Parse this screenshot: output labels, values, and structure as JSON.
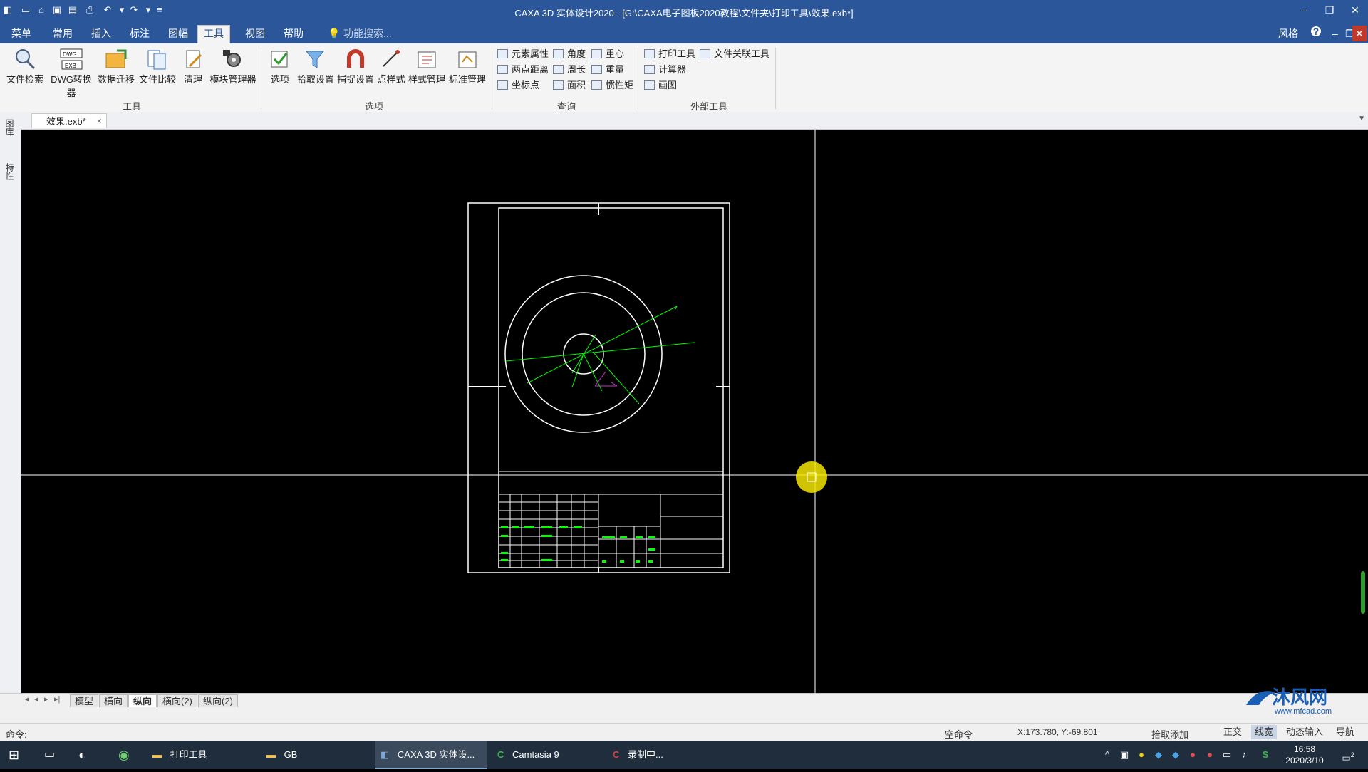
{
  "app": {
    "title": "CAXA 3D 实体设计2020 - [G:\\CAXA电子图板2020教程\\文件夹\\打印工具\\效果.exb*]",
    "style_label": "风格",
    "help_glyph": "?"
  },
  "menu_tabs": [
    "菜单",
    "常用",
    "插入",
    "标注",
    "图幅",
    "工具",
    "视图",
    "帮助"
  ],
  "active_tab": "工具",
  "search": {
    "placeholder": "功能搜索..."
  },
  "ribbon": {
    "tools": {
      "label": "工具",
      "buttons": [
        "文件检索",
        "DWG转换器",
        "数据迁移",
        "文件比较",
        "清理",
        "模块管理器"
      ]
    },
    "options": {
      "label": "选项",
      "buttons": [
        "选项",
        "拾取设置",
        "捕捉设置",
        "点样式",
        "样式管理",
        "标准管理"
      ]
    },
    "query": {
      "label": "查询",
      "items": [
        "元素属性",
        "角度",
        "重心",
        "两点距离",
        "周长",
        "重量",
        "坐标点",
        "面积",
        "惯性矩"
      ]
    },
    "external": {
      "label": "外部工具",
      "items": [
        "打印工具",
        "文件关联工具",
        "计算器",
        "画图"
      ]
    }
  },
  "document_tab": {
    "name": "效果.exb*",
    "close": "×"
  },
  "left_panel": {
    "items": [
      "图库",
      "特性"
    ]
  },
  "sheet_tabs": [
    "模型",
    "横向",
    "纵向",
    "横向(2)",
    "纵向(2)"
  ],
  "active_sheet": "纵向",
  "status": {
    "command_label": "命令:",
    "idle_command": "空命令",
    "coords": "X:173.780, Y:-69.801",
    "pick_mode": "拾取添加",
    "toggles": [
      "正交",
      "线宽",
      "动态输入",
      "导航"
    ],
    "active_toggle": "线宽"
  },
  "taskbar": {
    "apps": [
      "打印工具",
      "GB",
      "CAXA 3D 实体设...",
      "Camtasia 9",
      "录制中..."
    ],
    "active_app": "CAXA 3D 实体设...",
    "time": "16:58",
    "date": "2020/3/10",
    "notif_count": "2"
  },
  "watermark": {
    "text": "沐风网",
    "url": "www.mfcad.com"
  },
  "colors": {
    "ribbon_blue": "#2b579a",
    "canvas": "#000000",
    "drawing": "#ffffff",
    "dimension": "#00ff00",
    "cursor_highlight": "#f5e600"
  }
}
